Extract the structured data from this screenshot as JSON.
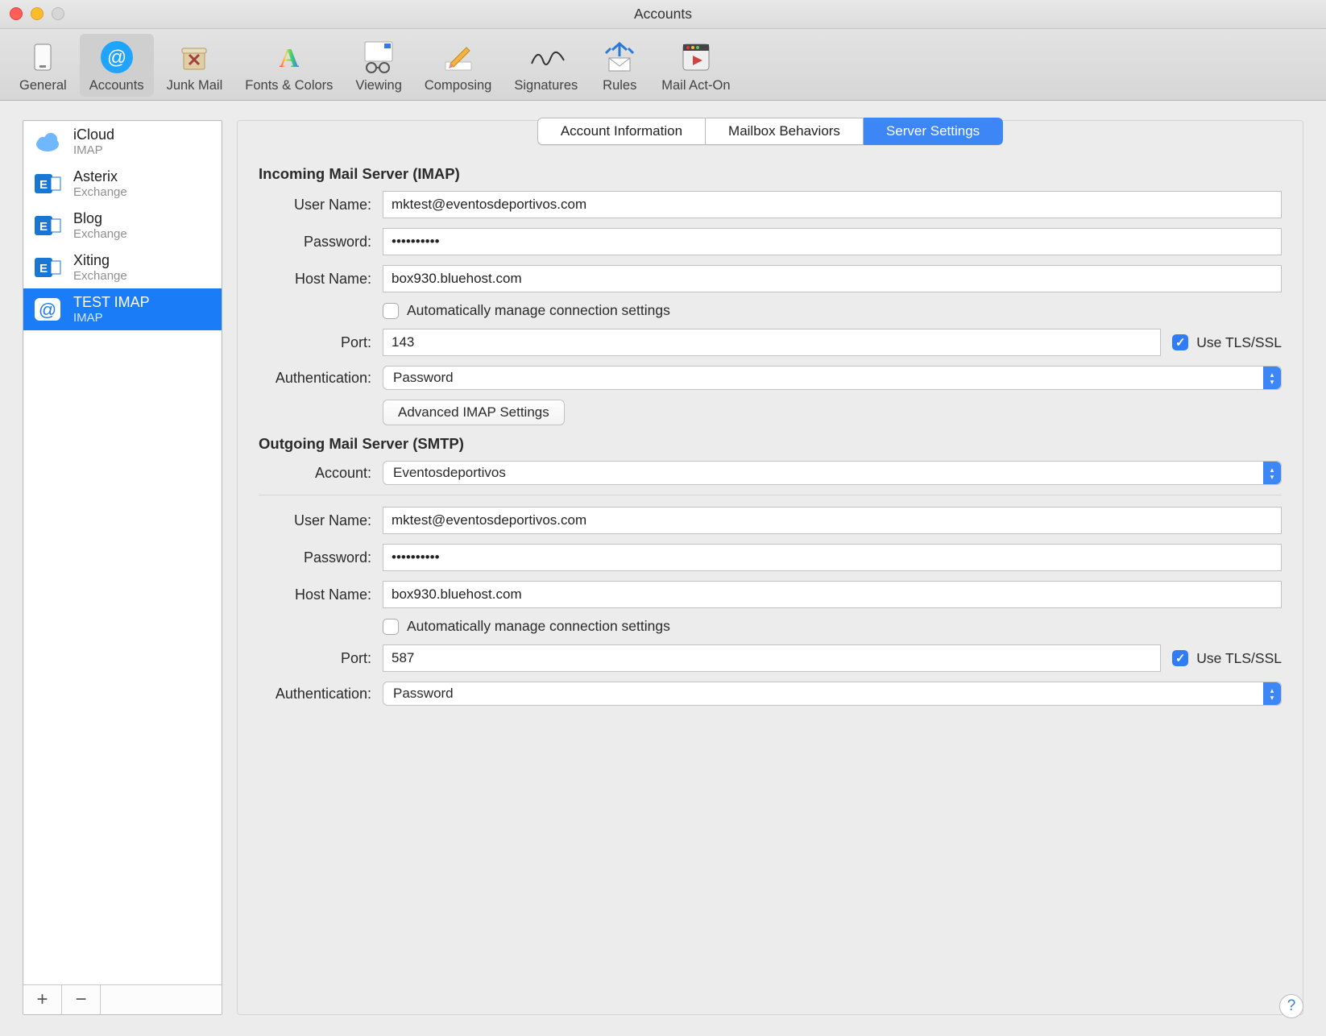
{
  "window": {
    "title": "Accounts"
  },
  "toolbar": {
    "items": [
      {
        "label": "General"
      },
      {
        "label": "Accounts"
      },
      {
        "label": "Junk Mail"
      },
      {
        "label": "Fonts & Colors"
      },
      {
        "label": "Viewing"
      },
      {
        "label": "Composing"
      },
      {
        "label": "Signatures"
      },
      {
        "label": "Rules"
      },
      {
        "label": "Mail Act-On"
      }
    ],
    "selected_index": 1
  },
  "sidebar": {
    "accounts": [
      {
        "name": "iCloud",
        "type": "IMAP"
      },
      {
        "name": "Asterix",
        "type": "Exchange"
      },
      {
        "name": "Blog",
        "type": "Exchange"
      },
      {
        "name": "Xiting",
        "type": "Exchange"
      },
      {
        "name": "TEST IMAP",
        "type": "IMAP"
      }
    ],
    "selected_index": 4,
    "footer": {
      "add": "+",
      "remove": "−"
    }
  },
  "tabs": {
    "items": [
      "Account Information",
      "Mailbox Behaviors",
      "Server Settings"
    ],
    "selected_index": 2
  },
  "incoming": {
    "section_title": "Incoming Mail Server (IMAP)",
    "labels": {
      "user": "User Name:",
      "password": "Password:",
      "host": "Host Name:",
      "auto": "Automatically manage connection settings",
      "port": "Port:",
      "tls": "Use TLS/SSL",
      "auth": "Authentication:",
      "advanced_btn": "Advanced IMAP Settings"
    },
    "user": "mktest@eventosdeportivos.com",
    "password": "••••••••••",
    "host": "box930.bluehost.com",
    "auto_checked": false,
    "port": "143",
    "tls_checked": true,
    "auth": "Password"
  },
  "outgoing": {
    "section_title": "Outgoing Mail Server (SMTP)",
    "labels": {
      "account": "Account:",
      "user": "User Name:",
      "password": "Password:",
      "host": "Host Name:",
      "auto": "Automatically manage connection settings",
      "port": "Port:",
      "tls": "Use TLS/SSL",
      "auth": "Authentication:"
    },
    "account": "Eventosdeportivos",
    "user": "mktest@eventosdeportivos.com",
    "password": "••••••••••",
    "host": "box930.bluehost.com",
    "auto_checked": false,
    "port": "587",
    "tls_checked": true,
    "auth": "Password"
  },
  "help_glyph": "?"
}
